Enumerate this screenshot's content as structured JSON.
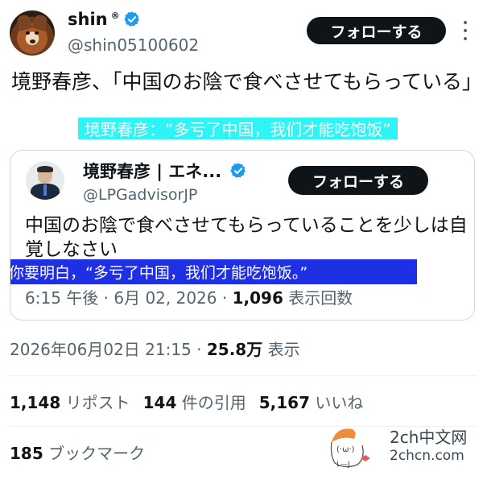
{
  "author": {
    "name": "shin",
    "registered_mark": "®",
    "handle": "@shin05100602",
    "follow_label": "フォローする"
  },
  "tweet": {
    "text": "境野春彦、「中国のお陰で食べさせてもらっている」",
    "overlay_caption": "境野春彦：“多亏了中国，我们才能吃饱饭”"
  },
  "quote": {
    "name": "境野春彦 | エネ...",
    "handle": "@LPGadvisorJP",
    "follow_label": "フォローする",
    "text": "中国のお陰で食べさせてもらっていることを少しは自覚しなさい",
    "overlay_caption": "你要明白，“多亏了中国，我们才能吃饱饭。”",
    "time": "6:15 午後",
    "date": "6月 02, 2026",
    "views": "1,096",
    "views_label": "表示回数"
  },
  "meta": {
    "datetime": "2026年06月02日 21:15",
    "views": "25.8万",
    "views_label": "表示"
  },
  "stats": {
    "reposts": "1,148",
    "reposts_label": "リポスト",
    "quotes": "144",
    "quotes_label": "件の引用",
    "likes": "5,167",
    "likes_label": "いいね",
    "bookmarks": "185",
    "bookmarks_label": "ブックマーク"
  },
  "watermark": {
    "line1": "2ch中文网",
    "line2": "2chcn.com"
  },
  "colors": {
    "verified": "#1d9bf0",
    "caption_cyan": "#2ef4f6",
    "caption_blue": "#1f2fe3"
  },
  "icons": [
    "verified-badge-icon",
    "more-options-icon",
    "watermark-mascot-icon"
  ]
}
